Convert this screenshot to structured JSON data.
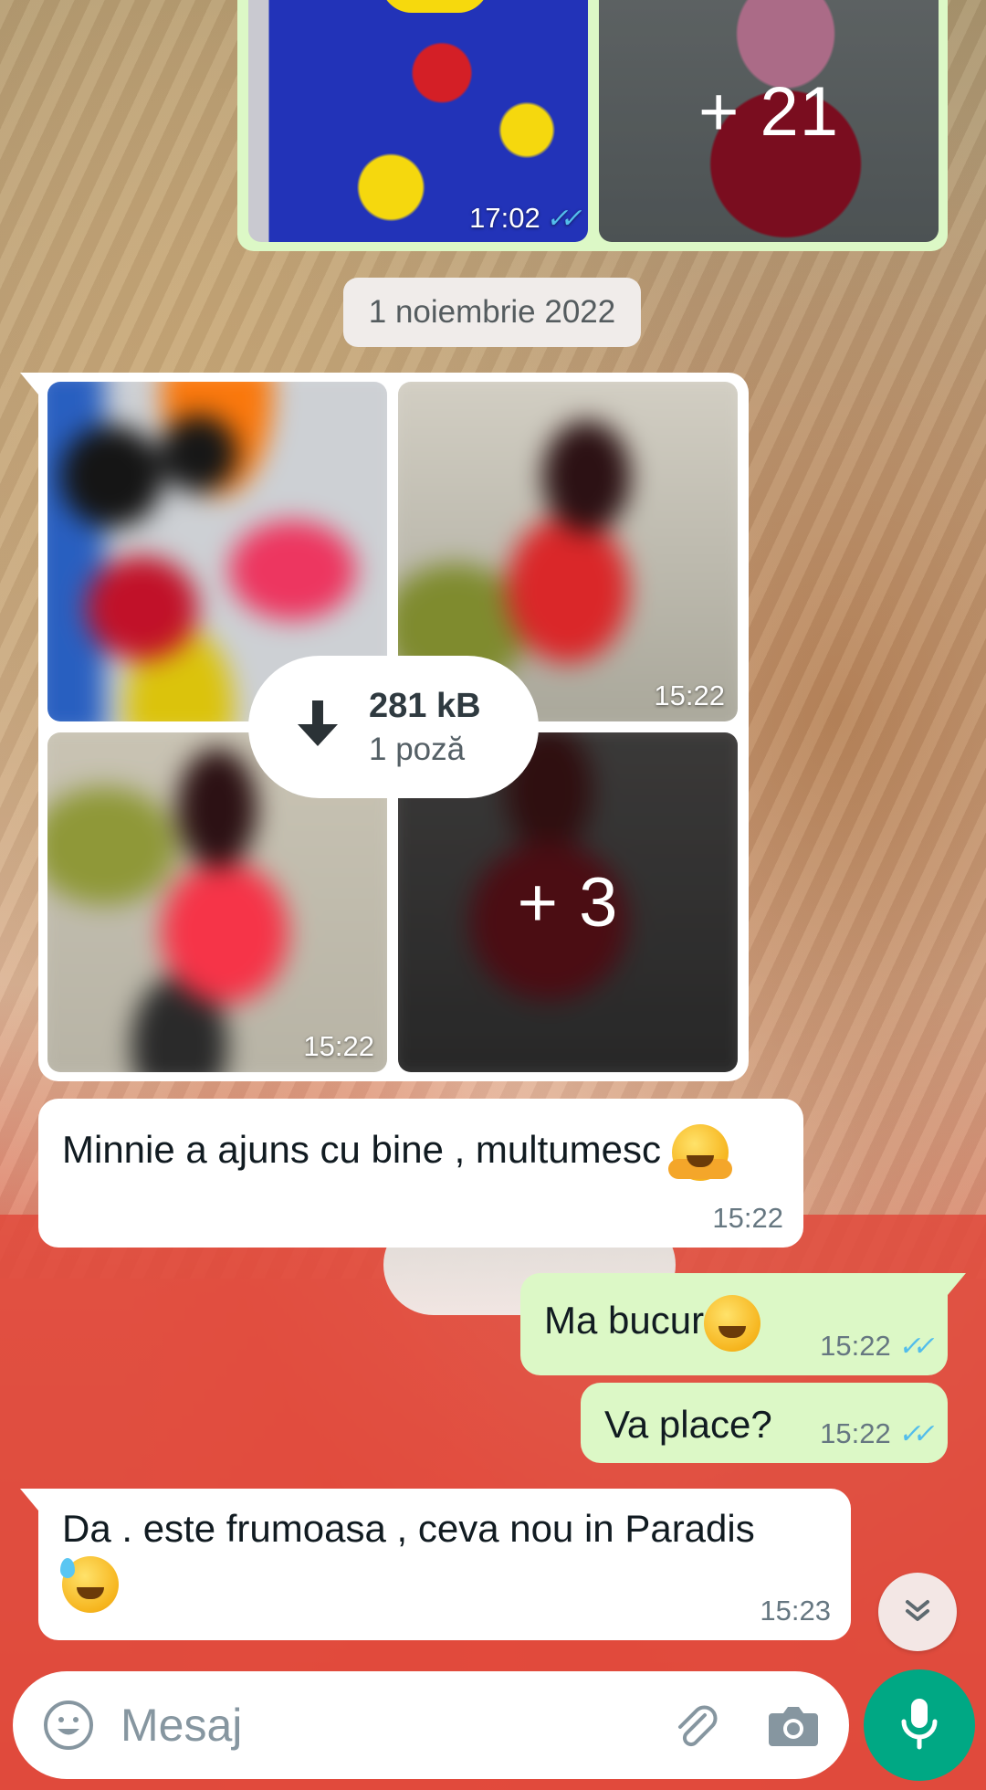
{
  "top_album": {
    "time": "17:02",
    "more_count": "+ 21",
    "status_icon": "double-check-icon"
  },
  "date_separator": "1 noiembrie 2022",
  "incoming_album": {
    "tile_times": [
      "15:22",
      "15:22"
    ],
    "more_count": "+ 3",
    "download": {
      "size": "281 kB",
      "count": "1 poză",
      "icon": "download-arrow-icon"
    }
  },
  "messages": [
    {
      "direction": "in",
      "text": "Minnie a ajuns cu bine , multumesc",
      "emoji": "hugging-face-emoji",
      "time": "15:22"
    },
    {
      "direction": "out",
      "text": "Ma bucur",
      "emoji": "smiling-face-emoji",
      "time": "15:22",
      "status": "read"
    },
    {
      "direction": "out",
      "text": "Va place?",
      "time": "15:22",
      "status": "read"
    },
    {
      "direction": "in",
      "text": "Da . este frumoasa , ceva nou in Paradis",
      "emoji": "grinning-sweat-emoji",
      "time": "15:23"
    }
  ],
  "composer": {
    "placeholder": "Mesaj"
  },
  "colors": {
    "outgoing_bubble": "#dcf8c6",
    "incoming_bubble": "#ffffff",
    "read_ticks": "#53bdeb",
    "mic_button": "#00a884"
  }
}
